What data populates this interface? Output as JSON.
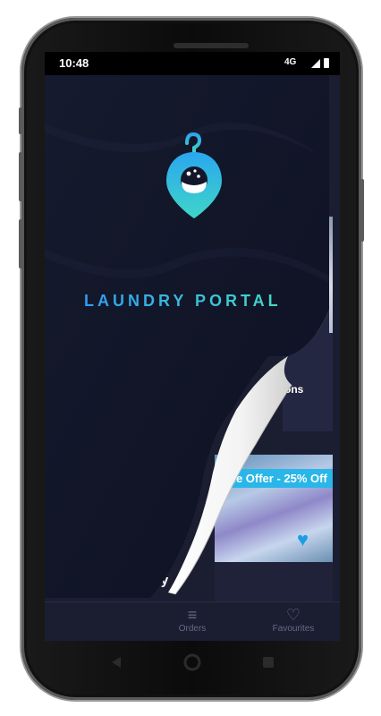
{
  "status_bar": {
    "time": "10:48",
    "network": "4G"
  },
  "splash": {
    "brand_name": "LAUNDRY PORTAL",
    "logo_icon": "hanger-pin-icon",
    "accent_colors": [
      "#2e9df2",
      "#44d9c4"
    ]
  },
  "content": {
    "card1_label": "ons",
    "card2_offer": "ne Offer - 25% Off",
    "card2_label": "ry"
  },
  "bottom_nav": {
    "items": [
      {
        "label": "Orders",
        "icon": "list-icon"
      },
      {
        "label": "Favourites",
        "icon": "heart-icon"
      }
    ]
  },
  "system_nav": {
    "back_icon": "back-triangle-icon",
    "home_icon": "home-circle-icon",
    "recents_icon": "recents-square-icon"
  }
}
